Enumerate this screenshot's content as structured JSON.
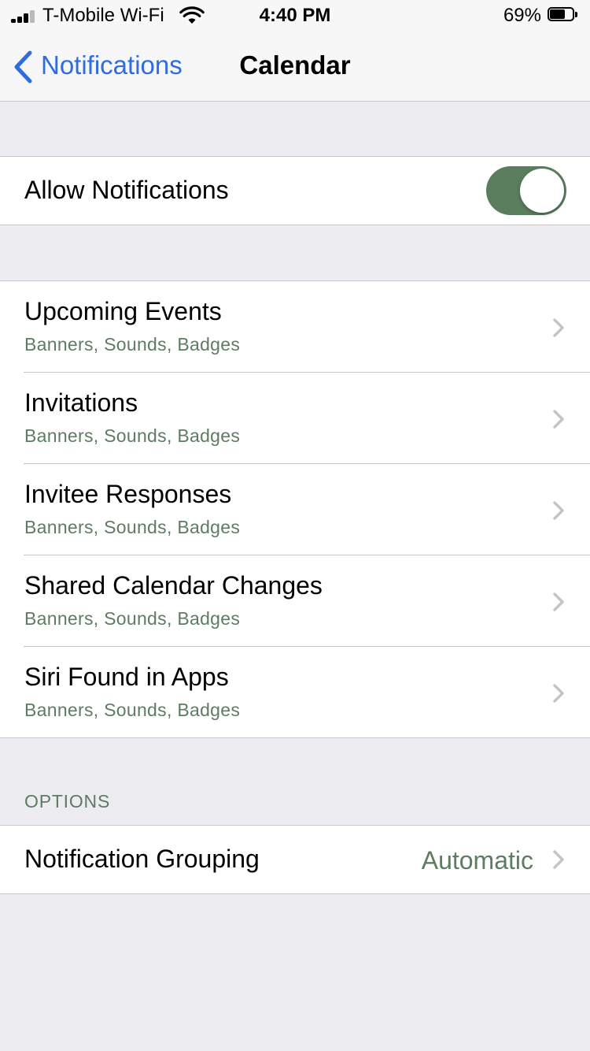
{
  "status_bar": {
    "carrier": "T-Mobile Wi-Fi",
    "time": "4:40 PM",
    "battery_percent": "69%",
    "battery_level": 0.69,
    "signal_bars": 3,
    "icons": [
      "signal-icon",
      "wifi-icon",
      "battery-icon"
    ]
  },
  "nav": {
    "back_label": "Notifications",
    "title": "Calendar"
  },
  "allow": {
    "label": "Allow Notifications",
    "enabled": true
  },
  "items": [
    {
      "title": "Upcoming Events",
      "subtitle": "Banners, Sounds, Badges"
    },
    {
      "title": "Invitations",
      "subtitle": "Banners, Sounds, Badges"
    },
    {
      "title": "Invitee Responses",
      "subtitle": "Banners, Sounds, Badges"
    },
    {
      "title": "Shared Calendar Changes",
      "subtitle": "Banners, Sounds, Badges"
    },
    {
      "title": "Siri Found in Apps",
      "subtitle": "Banners, Sounds, Badges"
    }
  ],
  "options": {
    "header": "OPTIONS",
    "grouping_label": "Notification Grouping",
    "grouping_value": "Automatic"
  },
  "colors": {
    "accent": "#2f6ce0",
    "toggle_on": "#5a7d5e",
    "secondary_text": "#5e7c62",
    "background": "#ececf1"
  }
}
